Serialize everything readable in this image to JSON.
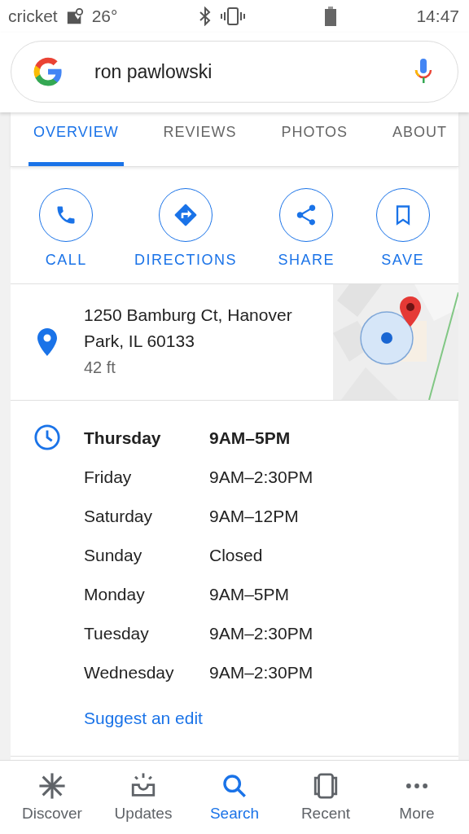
{
  "status_bar": {
    "carrier": "cricket",
    "temperature": "26°",
    "time": "14:47"
  },
  "search": {
    "value": "ron pawlowski"
  },
  "tabs": [
    {
      "label": "OVERVIEW",
      "selected": true
    },
    {
      "label": "REVIEWS",
      "selected": false
    },
    {
      "label": "PHOTOS",
      "selected": false
    },
    {
      "label": "ABOUT",
      "selected": false
    }
  ],
  "actions": [
    {
      "kind": "call",
      "label": "CALL"
    },
    {
      "kind": "directions",
      "label": "DIRECTIONS"
    },
    {
      "kind": "share",
      "label": "SHARE"
    },
    {
      "kind": "save",
      "label": "SAVE"
    }
  ],
  "address": {
    "lines": [
      "1250 Bamburg Ct, Hanover",
      "Park, IL 60133"
    ],
    "distance": "42 ft"
  },
  "hours": [
    {
      "day": "Thursday",
      "time": "9AM–5PM",
      "today": true
    },
    {
      "day": "Friday",
      "time": "9AM–2:30PM",
      "today": false
    },
    {
      "day": "Saturday",
      "time": "9AM–12PM",
      "today": false
    },
    {
      "day": "Sunday",
      "time": "Closed",
      "today": false
    },
    {
      "day": "Monday",
      "time": "9AM–5PM",
      "today": false
    },
    {
      "day": "Tuesday",
      "time": "9AM–2:30PM",
      "today": false
    },
    {
      "day": "Wednesday",
      "time": "9AM–2:30PM",
      "today": false
    }
  ],
  "suggest_edit": "Suggest an edit",
  "bottom_nav": [
    {
      "kind": "discover",
      "label": "Discover",
      "selected": false
    },
    {
      "kind": "updates",
      "label": "Updates",
      "selected": false
    },
    {
      "kind": "search",
      "label": "Search",
      "selected": true
    },
    {
      "kind": "recent",
      "label": "Recent",
      "selected": false
    },
    {
      "kind": "more",
      "label": "More",
      "selected": false
    }
  ]
}
